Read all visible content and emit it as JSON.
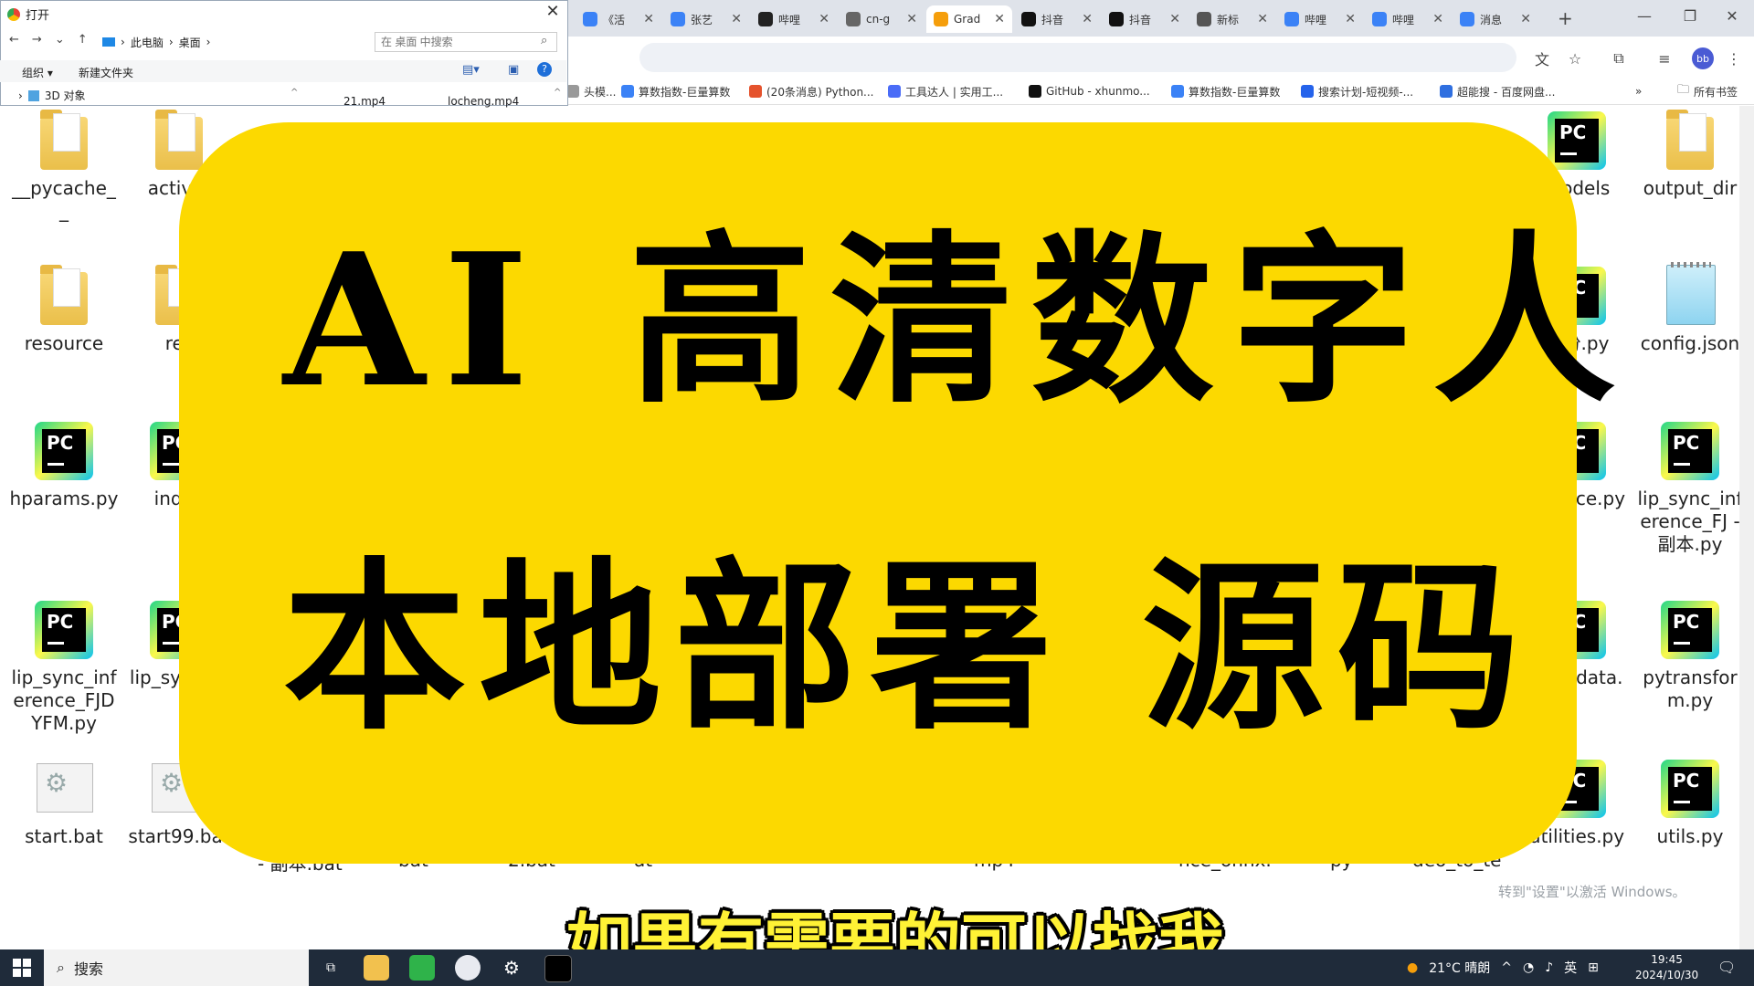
{
  "browser": {
    "tabs": [
      {
        "title": "《活",
        "color": "#3b82f6",
        "active": false
      },
      {
        "title": "张艺",
        "color": "#3b82f6",
        "active": false
      },
      {
        "title": "哔哩",
        "color": "#222222",
        "active": false
      },
      {
        "title": "cn-g",
        "color": "#666666",
        "active": false
      },
      {
        "title": "Grad",
        "color": "#f59e0b",
        "active": true
      },
      {
        "title": "抖音",
        "color": "#111111",
        "active": false
      },
      {
        "title": "抖音",
        "color": "#111111",
        "active": false
      },
      {
        "title": "新标",
        "color": "#555555",
        "active": false
      },
      {
        "title": "哔哩",
        "color": "#3b82f6",
        "active": false
      },
      {
        "title": "哔哩",
        "color": "#3b82f6",
        "active": false
      },
      {
        "title": "消息",
        "color": "#3b82f6",
        "active": false
      }
    ],
    "new_tab": "+",
    "bookmarks": [
      {
        "label": "头模...",
        "color": "#999999"
      },
      {
        "label": "算数指数-巨量算数",
        "color": "#3b82f6"
      },
      {
        "label": "(20条消息) Python...",
        "color": "#e5532d"
      },
      {
        "label": "工具达人 | 实用工...",
        "color": "#4a6cf7"
      },
      {
        "label": "GitHub - xhunmo...",
        "color": "#111111"
      },
      {
        "label": "算数指数-巨量算数",
        "color": "#3b82f6"
      },
      {
        "label": "搜索计划-短视频-...",
        "color": "#2563eb"
      },
      {
        "label": "超能搜 - 百度网盘...",
        "color": "#2f6fe0"
      }
    ],
    "bookmarks_more": "»",
    "all_bookmarks": "所有书签",
    "profile": "bb"
  },
  "dialog": {
    "title": "打开",
    "path": [
      "此电脑",
      "桌面"
    ],
    "search_placeholder": "在 桌面 中搜索",
    "organize": "组织 ▾",
    "new_folder": "新建文件夹",
    "tree_item": "3D 对象",
    "files": [
      "21.mp4",
      "locheng.mp4"
    ]
  },
  "desktop": {
    "icons": [
      {
        "label": "__pycache__",
        "type": "folder"
      },
      {
        "label": "activat",
        "type": "folder"
      },
      {
        "label": "models",
        "type": "pc"
      },
      {
        "label": "output_dir",
        "type": "folder"
      },
      {
        "label": "resource",
        "type": "folder"
      },
      {
        "label": "res",
        "type": "folder"
      },
      {
        "label": "备份.py",
        "type": "pc"
      },
      {
        "label": "config.json",
        "type": "note"
      },
      {
        "label": "hparams.py",
        "type": "pc"
      },
      {
        "label": "index",
        "type": "pc"
      },
      {
        "label": "nc_ince.py",
        "type": "pc"
      },
      {
        "label": "lip_sync_inference_FJ - 副本.py",
        "type": "pc"
      },
      {
        "label": "lip_sync_inference_FJDYFM.py",
        "type": "pc"
      },
      {
        "label": "lip_syferen",
        "type": "pc"
      },
      {
        "label": "re_mdata.",
        "type": "pc"
      },
      {
        "label": "pytransform.py",
        "type": "pc"
      },
      {
        "label": "start.bat",
        "type": "bat"
      },
      {
        "label": "start99.bat",
        "type": "bat"
      },
      {
        "label": "utilities.py",
        "type": "pc"
      },
      {
        "label": "utils.py",
        "type": "pc"
      }
    ],
    "partial_labels": [
      "- 副本.bat",
      "bat",
      "2.bat",
      "at",
      "mp4",
      "nce_onnx.",
      "py",
      "deo_to_te"
    ]
  },
  "overlay": {
    "line1": "AI 高清数字人",
    "line2": "本地部署 源码",
    "bg_color": "#fcd900"
  },
  "subtitle": "如果有需要的可以找我",
  "activation_hint": "转到\"设置\"以激活 Windows。",
  "taskbar": {
    "search_label": "搜索",
    "weather": "21°C 晴朗",
    "ime": "英",
    "time": "19:45",
    "date": "2024/10/30"
  }
}
